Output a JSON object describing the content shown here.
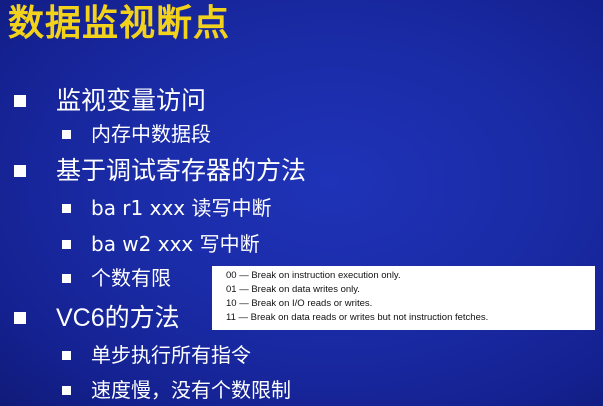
{
  "title": "数据监视断点",
  "bullets": [
    {
      "level": 1,
      "text": "监视变量访问"
    },
    {
      "level": 2,
      "text": "内存中数据段"
    },
    {
      "level": 1,
      "text": "基于调试寄存器的方法"
    },
    {
      "level": 2,
      "text": "ba r1 xxx 读写中断"
    },
    {
      "level": 2,
      "text": "ba w2 xxx 写中断"
    },
    {
      "level": 2,
      "text": "个数有限"
    },
    {
      "level": 1,
      "text": "VC6的方法"
    },
    {
      "level": 2,
      "text": "单步执行所有指令"
    },
    {
      "level": 2,
      "text": "速度慢，没有个数限制"
    }
  ],
  "note_lines": [
    "00 — Break on instruction execution only.",
    "01 — Break on data writes only.",
    "10 — Break on I/O reads or writes.",
    "11 — Break on data reads or writes but not instruction fetches."
  ],
  "colors": {
    "background": "#1a2ba6",
    "title": "#f2d21a",
    "text": "#ffffff",
    "note_background": "#ffffff",
    "note_text": "#111111"
  }
}
